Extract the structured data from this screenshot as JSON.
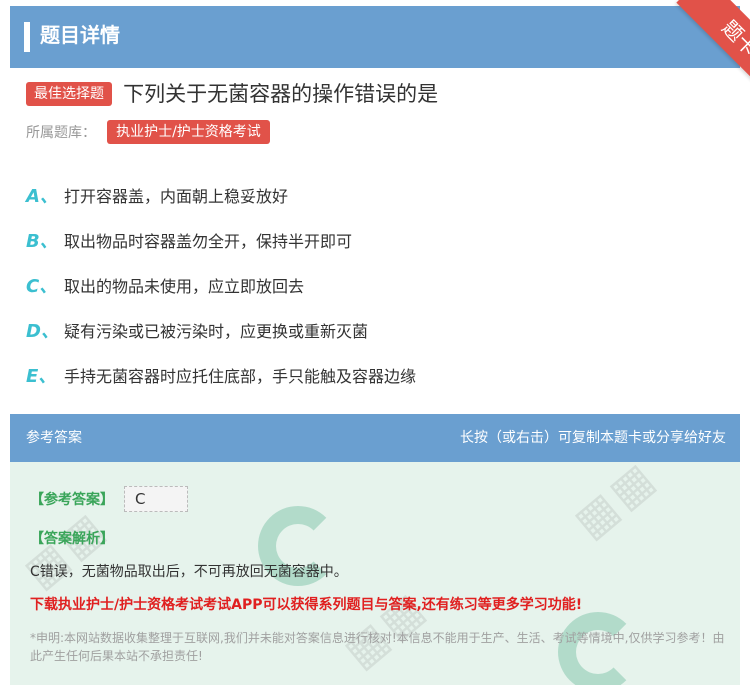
{
  "header": {
    "title": "题目详情",
    "ribbon": "题卡"
  },
  "question": {
    "badge": "最佳选择题",
    "text": "下列关于无菌容器的操作错误的是",
    "library_label": "所属题库：",
    "library_tag": "执业护士/护士资格考试"
  },
  "options": [
    {
      "letter": "A、",
      "text": "打开容器盖，内面朝上稳妥放好"
    },
    {
      "letter": "B、",
      "text": "取出物品时容器盖勿全开，保持半开即可"
    },
    {
      "letter": "C、",
      "text": "取出的物品未使用，应立即放回去"
    },
    {
      "letter": "D、",
      "text": "疑有污染或已被污染时，应更换或重新灭菌"
    },
    {
      "letter": "E、",
      "text": "手持无菌容器时应托住底部，手只能触及容器边缘"
    }
  ],
  "answer": {
    "head_left": "参考答案",
    "head_right": "长按（或右击）可复制本题卡或分享给好友",
    "ref_label": "【参考答案】",
    "ref_value": "C",
    "analysis_label": "【答案解析】",
    "analysis_text": "C错误，无菌物品取出后，不可再放回无菌容器中。",
    "promo": "下载执业护士/护士资格考试考试APP可以获得系列题目与答案,还有练习等更多学习功能!",
    "disclaimer": "*申明:本网站数据收集整理于互联网,我们并未能对答案信息进行核对!本信息不能用于生产、生活、考试等情境中,仅供学习参考！由此产生任何后果本站不承担责任!"
  },
  "colors": {
    "header_blue": "#6a9fd0",
    "accent_red": "#e15249",
    "option_letter": "#3bbfd0",
    "answer_green": "#3aa55a",
    "promo_red": "#e02020",
    "panel_bg": "#e6f3ec"
  }
}
